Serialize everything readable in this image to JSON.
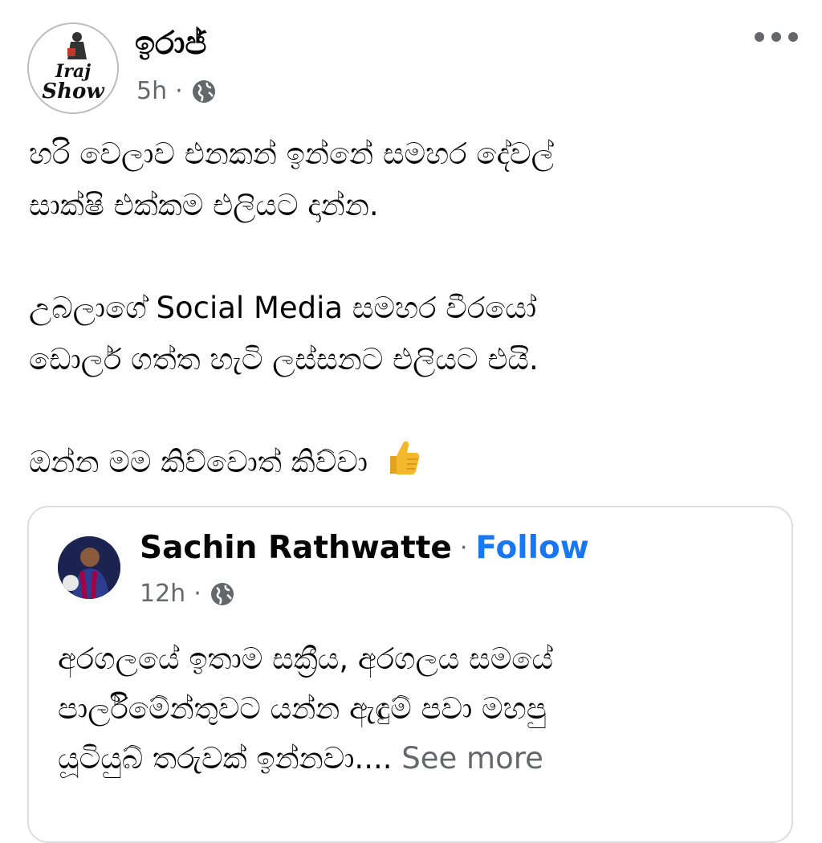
{
  "post": {
    "author": "ඉරාජ්",
    "avatar_text_top": "Iraj",
    "avatar_text_bottom": "Show",
    "time": "5h",
    "dot": "·",
    "privacy_icon": "globe-icon",
    "menu_icon": "more-horizontal-icon",
    "paragraphs": [
      [
        "හරි වෙලාව එනකන් ඉන්නේ සමහර දේවල්",
        "සාක්ෂි එක්කම එලියට දාන්න."
      ],
      [
        "උබලාගේ Social Media සමහර වීරයෝ",
        "ඩොලර් ගත්ත හැටි ලස්සනට එලියට එයි."
      ],
      [
        "ඔන්න මම කිව්වොත් කිව්වා"
      ]
    ],
    "emoji_icon": "thumbs-up-icon"
  },
  "shared": {
    "author": "Sachin Rathwatte",
    "dot": "·",
    "follow_label": "Follow",
    "time": "12h",
    "privacy_icon": "globe-icon",
    "lines": [
      "අරගලයේ ඉතාම සක්‍රීය, අරගලය සමයේ",
      "පාර්ලිමේන්තුවට යන්න ඇඳුම් පවා මහපු",
      "යූටියුබ් තරුවක් ඉන්නවා...."
    ],
    "see_more": "See more"
  },
  "colors": {
    "text": "#050505",
    "secondary": "#65676b",
    "link": "#1877f2",
    "thumbs": "#f5b72b",
    "border": "#dadde1"
  }
}
